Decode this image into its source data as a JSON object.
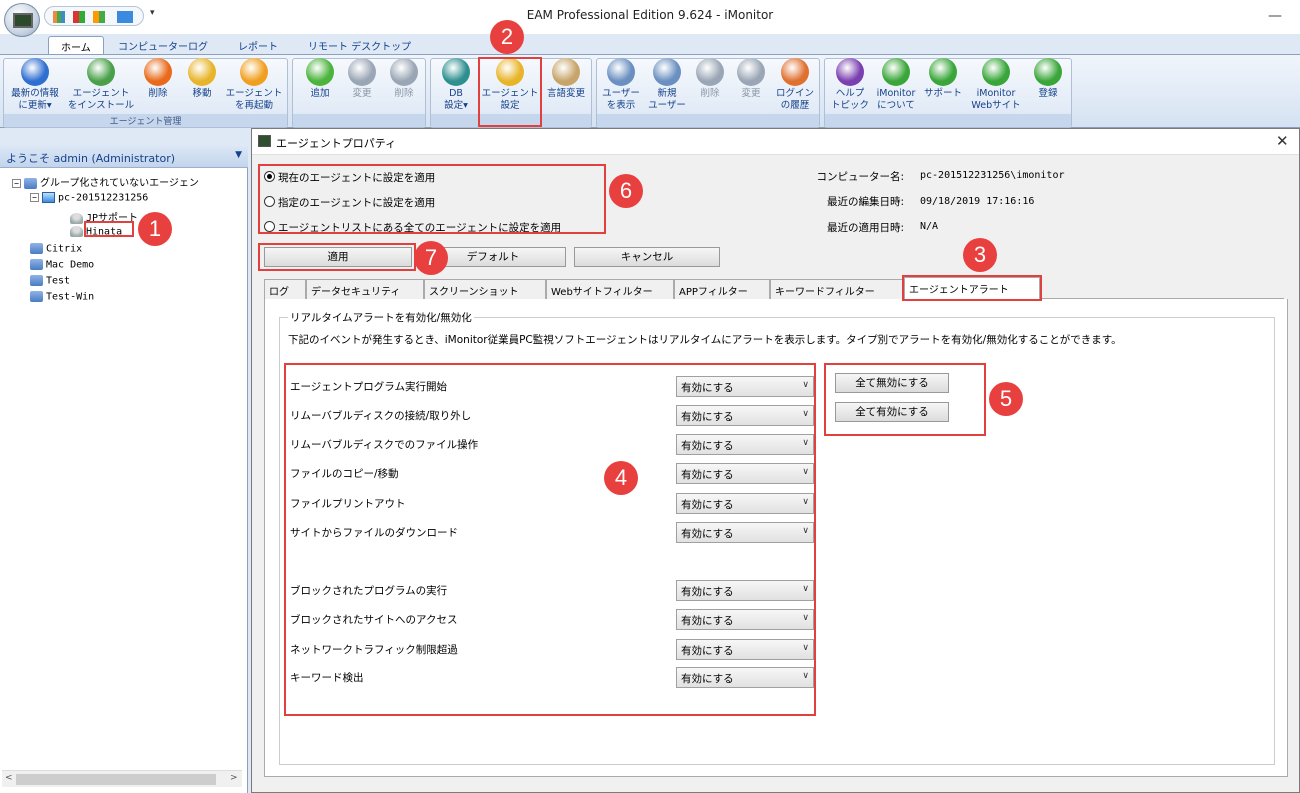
{
  "window": {
    "title": "EAM Professional Edition 9.624 - iMonitor",
    "min_glyph": "—",
    "qat_dropdown": "▾"
  },
  "ribbon_tabs": [
    "ホーム",
    "コンピューターログ",
    "レポート",
    "リモート デスクトップ"
  ],
  "ribbon": {
    "groups": {
      "agent_mgmt": "エージェント管理"
    },
    "buttons": [
      {
        "l1": "最新の情報",
        "l2": "に更新▾",
        "icon": "refresh-icon",
        "color": "#2f6fd0"
      },
      {
        "l1": "エージェント",
        "l2": "をインストール",
        "icon": "install-agent-icon",
        "color": "#4aa04a"
      },
      {
        "l1": "削除",
        "l2": "",
        "icon": "delete-icon",
        "color": "#e86a1a"
      },
      {
        "l1": "移動",
        "l2": "",
        "icon": "move-icon",
        "color": "#e8b52a"
      },
      {
        "l1": "エージェント",
        "l2": "を再起動",
        "icon": "restart-icon",
        "color": "#f0a020"
      },
      {
        "l1": "追加",
        "l2": "",
        "icon": "add-icon",
        "color": "#4cb33c"
      },
      {
        "l1": "変更",
        "l2": "",
        "icon": "edit-icon",
        "color": "#9aa6b5"
      },
      {
        "l1": "削除",
        "l2": "",
        "icon": "delete-disabled-icon",
        "color": "#9aa6b5"
      },
      {
        "l1": "DB",
        "l2": "設定▾",
        "icon": "database-icon",
        "color": "#2f8f8f"
      },
      {
        "l1": "エージェント",
        "l2": "設定",
        "icon": "agent-settings-icon",
        "color": "#e8b52a"
      },
      {
        "l1": "言語変更",
        "l2": "",
        "icon": "language-icon",
        "color": "#c7a56a"
      },
      {
        "l1": "ユーザー",
        "l2": "を表示",
        "icon": "users-icon",
        "color": "#6a8fc0"
      },
      {
        "l1": "新規",
        "l2": "ユーザー",
        "icon": "new-user-icon",
        "color": "#6a8fc0"
      },
      {
        "l1": "削除",
        "l2": "",
        "icon": "delete-user-icon",
        "color": "#9aa6b5"
      },
      {
        "l1": "変更",
        "l2": "",
        "icon": "edit-user-icon",
        "color": "#9aa6b5"
      },
      {
        "l1": "ログイン",
        "l2": "の履歴",
        "icon": "login-history-icon",
        "color": "#e07030"
      },
      {
        "l1": "ヘルプ",
        "l2": "トピック",
        "icon": "help-icon",
        "color": "#7a3fb0"
      },
      {
        "l1": "iMonitor",
        "l2": "について",
        "icon": "about-icon",
        "color": "#3aa63a"
      },
      {
        "l1": "サポート",
        "l2": "",
        "icon": "support-icon",
        "color": "#3aa63a"
      },
      {
        "l1": "iMonitor",
        "l2": "Webサイト",
        "icon": "website-icon",
        "color": "#3aa63a"
      },
      {
        "l1": "登録",
        "l2": "",
        "icon": "register-icon",
        "color": "#3aa63a"
      }
    ]
  },
  "leftpanel": {
    "welcome": "ようこそ admin (Administrator)",
    "tree": {
      "root": "グループ化されていないエージェン",
      "pc": "pc-201512231256",
      "user1": "JPサポート",
      "user2": "Hinata",
      "groups": [
        "Citrix",
        "Mac Demo",
        "Test",
        "Test-Win"
      ]
    }
  },
  "dialog": {
    "title": "エージェントプロパティ",
    "radios": [
      {
        "label": "現在のエージェントに設定を適用",
        "selected": true
      },
      {
        "label": "指定のエージェントに設定を適用",
        "selected": false
      },
      {
        "label": "エージェントリストにある全てのエージェントに設定を適用",
        "selected": false
      }
    ],
    "info": {
      "computer_label": "コンピューター名:",
      "computer_value": "pc-201512231256\\imonitor",
      "edited_label": "最近の編集日時:",
      "edited_value": "09/18/2019 17:16:16",
      "applied_label": "最近の適用日時:",
      "applied_value": "N/A"
    },
    "buttons": {
      "apply": "適用",
      "default": "デフォルト",
      "cancel": "キャンセル"
    },
    "tabs": [
      "ログ",
      "データセキュリティ",
      "スクリーンショット",
      "Webサイトフィルター",
      "APPフィルター",
      "キーワードフィルター",
      "エージェントアラート"
    ],
    "panel": {
      "group_title": "リアルタイムアラートを有効化/無効化",
      "description": "下記のイベントが発生するとき、iMonitor従業員PC監視ソフトエージェントはリアルタイムにアラートを表示します。タイプ別でアラートを有効化/無効化することができます。",
      "disable_all": "全て無効にする",
      "enable_all": "全て有効にする",
      "alerts": [
        {
          "label": "エージェントプログラム実行開始",
          "value": "有効にする"
        },
        {
          "label": "リムーバブルディスクの接続/取り外し",
          "value": "有効にする"
        },
        {
          "label": "リムーバブルディスクでのファイル操作",
          "value": "有効にする"
        },
        {
          "label": "ファイルのコピー/移動",
          "value": "有効にする"
        },
        {
          "label": "ファイルプリントアウト",
          "value": "有効にする"
        },
        {
          "label": "サイトからファイルのダウンロード",
          "value": "有効にする"
        },
        {
          "label": "ブロックされたプログラムの実行",
          "value": "有効にする"
        },
        {
          "label": "ブロックされたサイトへのアクセス",
          "value": "有効にする"
        },
        {
          "label": "ネットワークトラフィック制限超過",
          "value": "有効にする"
        },
        {
          "label": "キーワード検出",
          "value": "有効にする"
        }
      ]
    }
  },
  "annotations": [
    "1",
    "2",
    "3",
    "4",
    "5",
    "6",
    "7"
  ],
  "colors": {
    "annotation": "#e0403e",
    "ribbon_text": "#15428b"
  }
}
